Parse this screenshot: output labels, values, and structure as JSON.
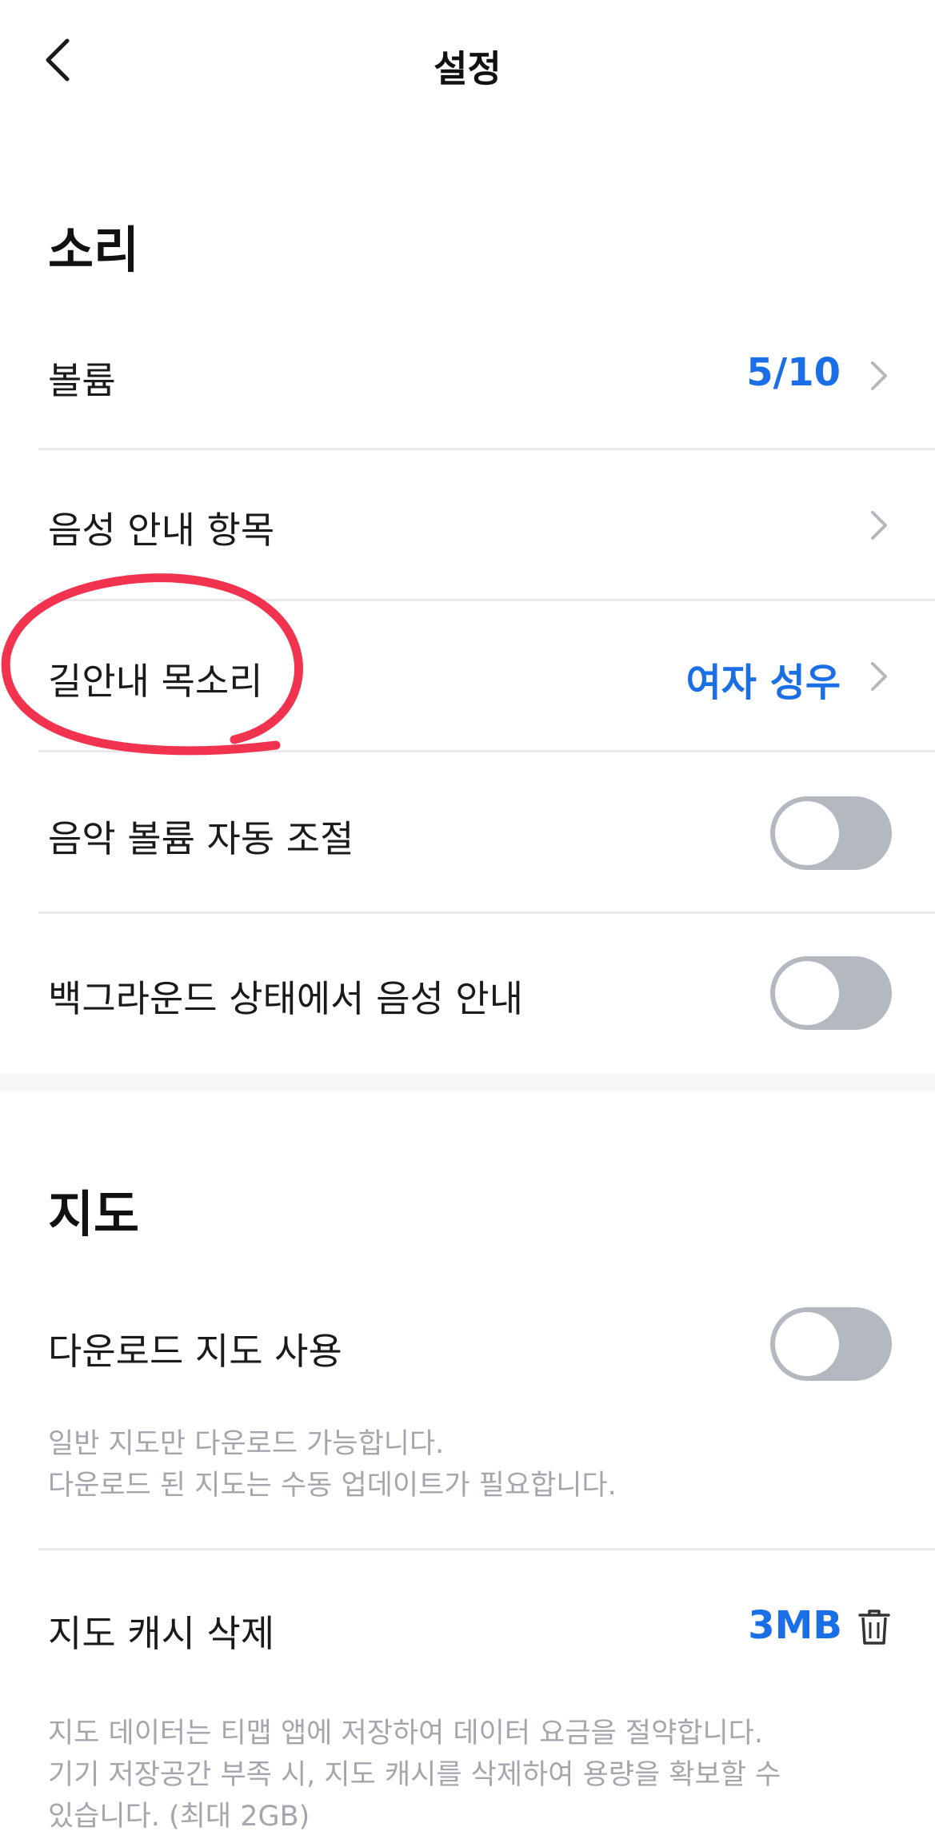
{
  "header": {
    "title": "설정",
    "back_icon": "chevron-left-icon"
  },
  "sections": {
    "sound": {
      "title": "소리",
      "volume": {
        "label": "볼륨",
        "value": "5/10"
      },
      "voice_items": {
        "label": "음성 안내 항목"
      },
      "guide_voice": {
        "label": "길안내 목소리",
        "value": "여자 성우"
      },
      "music_auto": {
        "label": "음악 볼륨 자동 조절",
        "toggle_on": false
      },
      "background_voice": {
        "label": "백그라운드 상태에서 음성 안내",
        "toggle_on": false
      }
    },
    "map": {
      "title": "지도",
      "download_map": {
        "label": "다운로드 지도 사용",
        "toggle_on": false,
        "help_line1": "일반 지도만 다운로드 가능합니다.",
        "help_line2": "다운로드 된 지도는 수동 업데이트가 필요합니다."
      },
      "map_cache": {
        "label": "지도 캐시 삭제",
        "value": "3MB",
        "icon": "trash-icon",
        "help_line1": "지도 데이터는 티맵 앱에 저장하여 데이터 요금을 절약합니다.",
        "help_line2": "기기 저장공간 부족 시, 지도 캐시를 삭제하여 용량을 확보할 수",
        "help_line3": "있습니다. (최대 2GB)"
      }
    }
  },
  "colors": {
    "accent": "#1b6fe6",
    "toggle_off": "#b4b8bf",
    "divider": "#e9e9ec",
    "helper_text": "#a3a7ad",
    "annotation": "#f2334f"
  }
}
